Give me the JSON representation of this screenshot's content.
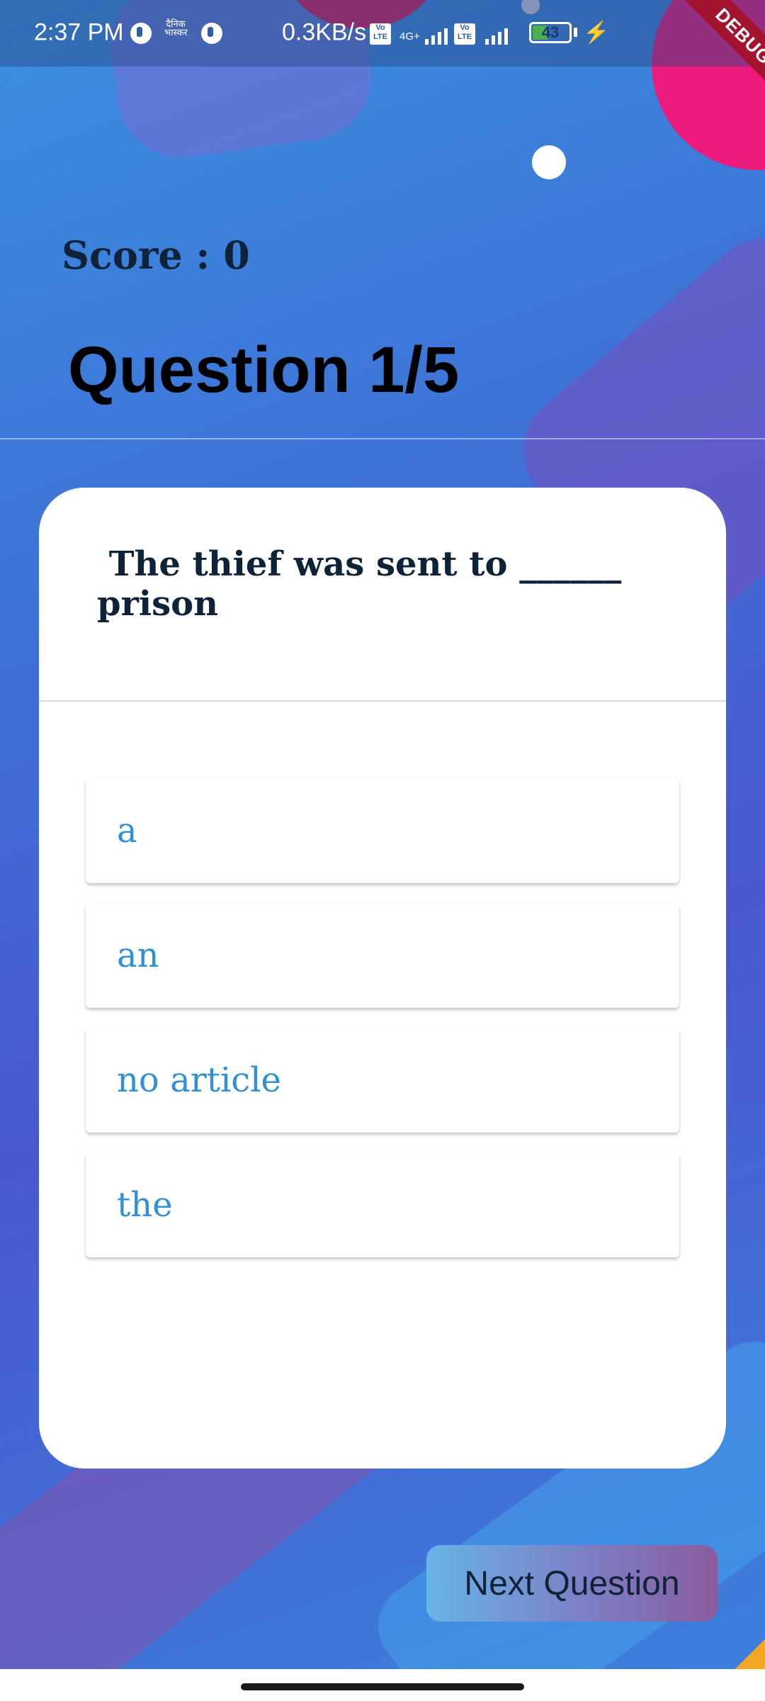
{
  "status_bar": {
    "time": "2:37 PM",
    "network_speed": "0.3KB/s",
    "network_type": "4G+",
    "volte_label": "Vo\nLTE",
    "battery_level": "43",
    "battery_fraction": 0.43,
    "app_icon_text": "दैनिक\nभास्कर"
  },
  "debug_banner": "DEBUG",
  "quiz": {
    "score_label": "Score : 0",
    "question_counter": "Question 1/5",
    "question_text": " The thief was sent to ______\nprison",
    "options": [
      {
        "label": "a"
      },
      {
        "label": "an"
      },
      {
        "label": "no article"
      },
      {
        "label": "the"
      }
    ],
    "next_button_label": "Next Question"
  },
  "colors": {
    "option_text": "#2f8fd8",
    "heading_text": "#0f2338",
    "debug_ribbon": "#a31431"
  }
}
